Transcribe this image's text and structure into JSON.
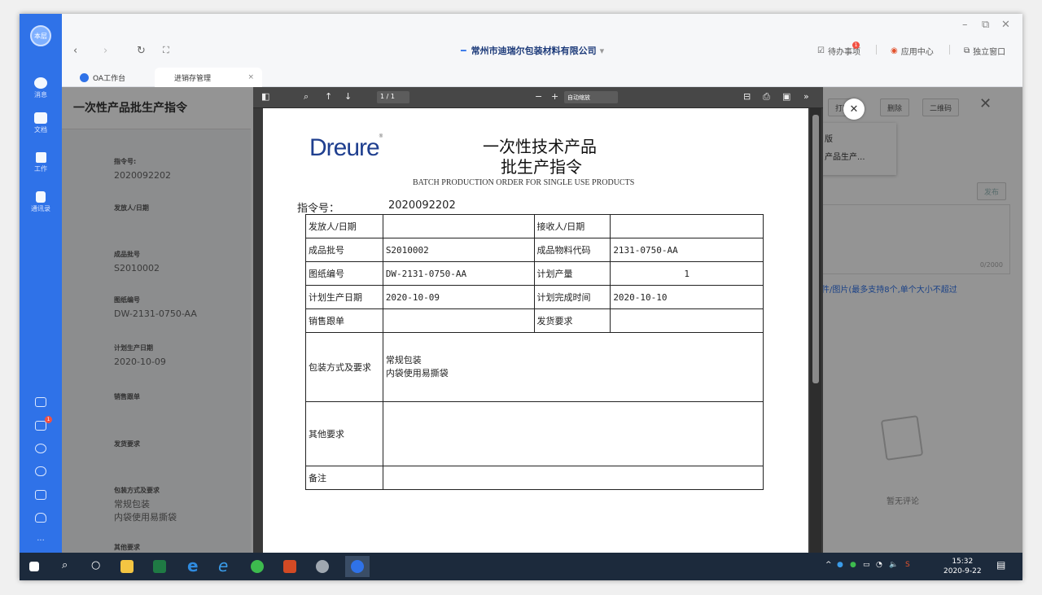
{
  "window": {
    "company": "常州市迪瑞尔包装材料有限公司",
    "todo_label": "待办事项",
    "todo_badge": "1",
    "app_center": "应用中心",
    "standalone": "独立窗口"
  },
  "rail": {
    "avatar": "本层",
    "items": [
      {
        "label": "消息"
      },
      {
        "label": "文档"
      },
      {
        "label": "工作"
      },
      {
        "label": "通讯录"
      }
    ],
    "lower_badge": "1"
  },
  "tabs": [
    {
      "label": "OA工作台"
    },
    {
      "label": "进销存管理"
    }
  ],
  "detail": {
    "title": "一次性产品批生产指令",
    "fields": [
      {
        "key": "指令号:",
        "value": "2020092202"
      },
      {
        "key": "发放人/日期",
        "value": ""
      },
      {
        "key": "成品批号",
        "value": "S2010002"
      },
      {
        "key": "图纸编号",
        "value": "DW-2131-0750-AA"
      },
      {
        "key": "计划生产日期",
        "value": "2020-10-09"
      },
      {
        "key": "销售跟单",
        "value": ""
      },
      {
        "key": "发货要求",
        "value": ""
      },
      {
        "key": "包装方式及要求",
        "value": "常规包装"
      },
      {
        "key": "",
        "value": "内袋使用易撕袋"
      },
      {
        "key": "其他要求",
        "value": ""
      }
    ]
  },
  "viewer": {
    "page_indicator": "1 / 1",
    "zoom": "自动缩放",
    "doc": {
      "logo": "Dreure",
      "title_line1": "一次性技术产品",
      "title_line2": "批生产指令",
      "subtitle": "BATCH PRODUCTION ORDER FOR SINGLE USE PRODUCTS",
      "order_label": "指令号：",
      "order_no": "2020092202",
      "rows": [
        {
          "l1": "发放人/日期",
          "v1": "",
          "l2": "接收人/日期",
          "v2": ""
        },
        {
          "l1": "成品批号",
          "v1": "S2010002",
          "l2": "成品物料代码",
          "v2": "2131-0750-AA"
        },
        {
          "l1": "图纸编号",
          "v1": "DW-2131-0750-AA",
          "l2": "计划产量",
          "v2": "1"
        },
        {
          "l1": "计划生产日期",
          "v1": "2020-10-09",
          "l2": "计划完成时间",
          "v2": "2020-10-10"
        },
        {
          "l1": "销售跟单",
          "v1": "",
          "l2": "发货要求",
          "v2": ""
        }
      ],
      "packing_label": "包装方式及要求",
      "packing_line1": "常规包装",
      "packing_line2": "内袋使用易撕袋",
      "other_label": "其他要求",
      "remark_label": "备注"
    }
  },
  "rpanel": {
    "print": "打印",
    "delete": "删除",
    "qrcode": "二维码",
    "menu1": "版",
    "menu2": "产品生产...",
    "publish": "发布",
    "counter": "0/2000",
    "attach_hint": "件/图片(最多支持8个,单个大小不超过",
    "no_comment": "暂无评论"
  },
  "taskbar": {
    "time": "15:32",
    "date": "2020-9-22"
  }
}
